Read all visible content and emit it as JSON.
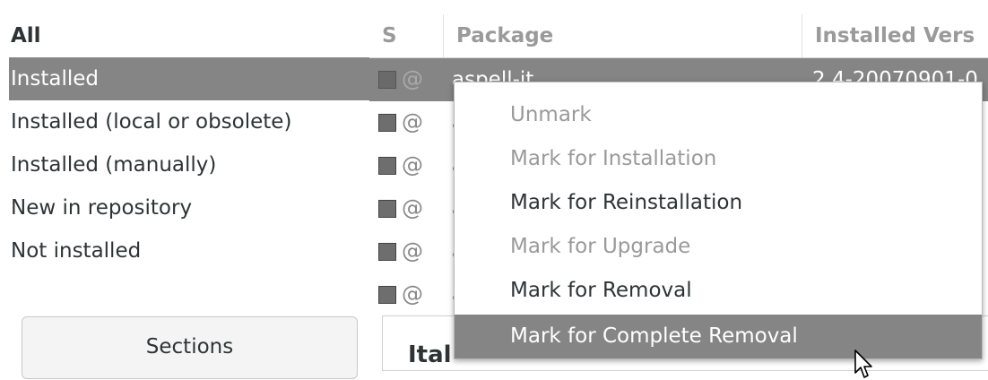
{
  "filters": {
    "items": [
      {
        "label": "All"
      },
      {
        "label": "Installed"
      },
      {
        "label": "Installed (local or obsolete)"
      },
      {
        "label": "Installed (manually)"
      },
      {
        "label": "New in repository"
      },
      {
        "label": "Not installed"
      }
    ],
    "selected": "Installed",
    "sections_button": "Sections"
  },
  "packages": {
    "columns": {
      "status": "S",
      "package": "Package",
      "installed_version": "Installed Vers"
    },
    "rows": [
      {
        "name": "aspell-it",
        "version": "2.4-20070901-0"
      },
      {
        "name": "a"
      },
      {
        "name": "a"
      },
      {
        "name": "a"
      },
      {
        "name": "a"
      },
      {
        "name": "a"
      }
    ]
  },
  "description": {
    "title": "Ital"
  },
  "context_menu": {
    "items": [
      {
        "label": "Unmark",
        "state": "disabled"
      },
      {
        "label": "Mark for Installation",
        "state": "disabled"
      },
      {
        "label": "Mark for Reinstallation",
        "state": "enabled"
      },
      {
        "label": "Mark for Upgrade",
        "state": "disabled"
      },
      {
        "label": "Mark for Removal",
        "state": "enabled"
      },
      {
        "label": "Mark for Complete Removal",
        "state": "highlighted"
      }
    ]
  },
  "icons": {
    "status": "status-checkbox-icon",
    "origin": "debian-swirl-icon",
    "pointer": "mouse-pointer-icon"
  },
  "colors": {
    "selection": "#858585",
    "disabled_text": "#9a9a9a",
    "text": "#2e3436",
    "header_text": "#9a9a9a"
  }
}
